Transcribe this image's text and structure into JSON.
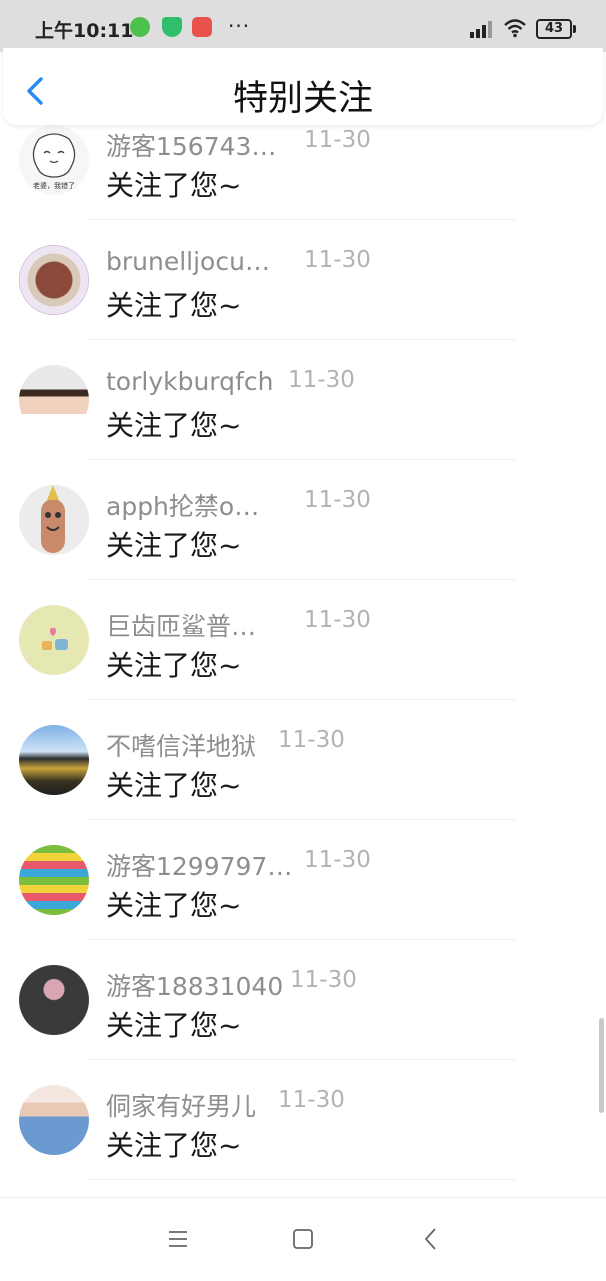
{
  "status_bar": {
    "time": "上午10:11",
    "more": "···",
    "battery": "43",
    "icons": [
      "wechat-icon",
      "shield-icon",
      "app-icon",
      "signal-icon",
      "wifi-icon",
      "battery-icon"
    ]
  },
  "header": {
    "title": "特别关注",
    "back_icon": "chevron-left-icon"
  },
  "accent_color": "#2a8cf0",
  "items": [
    {
      "name": "游客156743…",
      "date": "11-30",
      "message": "关注了您~"
    },
    {
      "name": "brunelljocu…",
      "date": "11-30",
      "message": "关注了您~"
    },
    {
      "name": "torlykburqfch",
      "date": "11-30",
      "message": "关注了您~"
    },
    {
      "name": "apph抡禁o…",
      "date": "11-30",
      "message": "关注了您~"
    },
    {
      "name": "巨齿匝鲨普…",
      "date": "11-30",
      "message": "关注了您~"
    },
    {
      "name": "不嗜信洋地狱",
      "date": "11-30",
      "message": "关注了您~"
    },
    {
      "name": "游客1299797…",
      "date": "11-30",
      "message": "关注了您~"
    },
    {
      "name": "游客18831040",
      "date": "11-30",
      "message": "关注了您~"
    },
    {
      "name": "侗家有好男儿",
      "date": "11-30",
      "message": "关注了您~"
    }
  ],
  "avatar_text_0": "老婆，我错了",
  "nav_bar": {
    "icons": [
      "menu-icon",
      "home-icon",
      "back-icon"
    ]
  }
}
